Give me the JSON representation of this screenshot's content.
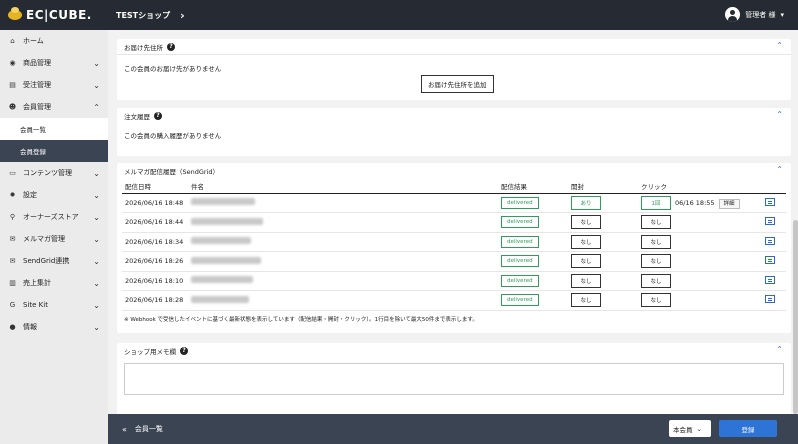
{
  "header": {
    "logo_text": "EC|CUBE.",
    "shop_name": "TESTショップ",
    "user_name": "管理者 様"
  },
  "sidebar": {
    "items": [
      {
        "icon": "home-icon",
        "glyph": "⌂",
        "label": "ホーム",
        "chevron": ""
      },
      {
        "icon": "tag-icon",
        "glyph": "◉",
        "label": "商品管理",
        "chevron": "⌄"
      },
      {
        "icon": "cart-icon",
        "glyph": "▤",
        "label": "受注管理",
        "chevron": "⌄"
      },
      {
        "icon": "users-icon",
        "glyph": "☻",
        "label": "会員管理",
        "chevron": "⌃"
      },
      {
        "icon": "file-icon",
        "glyph": "▭",
        "label": "コンテンツ管理",
        "chevron": "⌄"
      },
      {
        "icon": "gear-icon",
        "glyph": "✹",
        "label": "設定",
        "chevron": "⌄"
      },
      {
        "icon": "plug-icon",
        "glyph": "⚲",
        "label": "オーナーズストア",
        "chevron": "⌄"
      },
      {
        "icon": "mail-icon",
        "glyph": "✉",
        "label": "メルマガ管理",
        "chevron": "⌄"
      },
      {
        "icon": "send-icon",
        "glyph": "✉",
        "label": "SendGrid連携",
        "chevron": "⌄"
      },
      {
        "icon": "chart-icon",
        "glyph": "▥",
        "label": "売上集計",
        "chevron": "⌄"
      },
      {
        "icon": "google-icon",
        "glyph": "G",
        "label": "Site Kit",
        "chevron": "⌄"
      },
      {
        "icon": "info-icon",
        "glyph": "●",
        "label": "情報",
        "chevron": "⌄"
      }
    ],
    "sub_items": [
      {
        "label": "会員一覧"
      },
      {
        "label": "会員登録"
      }
    ]
  },
  "shipping": {
    "title": "お届け先住所",
    "empty_text": "この会員のお届け先がありません",
    "add_button": "お届け先住所を追加"
  },
  "orders": {
    "title": "注文履歴",
    "empty_text": "この会員の購入履歴がありません"
  },
  "maillog": {
    "title": "メルマガ配信履歴（SendGrid）",
    "columns": {
      "date": "配信日時",
      "subject": "件名",
      "result": "配信結果",
      "open": "開封",
      "click": "クリック"
    },
    "rows": [
      {
        "date": "2026/06/16 18:48",
        "result": "delivered",
        "open": "あり",
        "click": "1回",
        "click_detail": "06/16 18:55",
        "detail_label": "詳細"
      },
      {
        "date": "2026/06/16 18:44",
        "result": "delivered",
        "open": "なし",
        "click": "なし",
        "click_detail": "",
        "detail_label": ""
      },
      {
        "date": "2026/06/16 18:34",
        "result": "delivered",
        "open": "なし",
        "click": "なし",
        "click_detail": "",
        "detail_label": ""
      },
      {
        "date": "2026/06/16 18:26",
        "result": "delivered",
        "open": "なし",
        "click": "なし",
        "click_detail": "",
        "detail_label": ""
      },
      {
        "date": "2026/06/16 18:10",
        "result": "delivered",
        "open": "なし",
        "click": "なし",
        "click_detail": "",
        "detail_label": ""
      },
      {
        "date": "2026/06/16 18:28",
        "result": "delivered",
        "open": "なし",
        "click": "なし",
        "click_detail": "",
        "detail_label": ""
      }
    ],
    "note": "※ Webhook で受信したイベントに基づく最新状態を表示しています（配信結果・開封・クリック）。1行目を除いて最大50件まで表示します。"
  },
  "memo": {
    "title": "ショップ用メモ欄"
  },
  "footer": {
    "back_label": "会員一覧",
    "status_value": "本会員",
    "register_button": "登録"
  },
  "colors": {
    "header_bg": "#262b33",
    "footer_bg": "#3b4453",
    "primary": "#2e74d6",
    "delivered_green": "#2f9e5b"
  }
}
